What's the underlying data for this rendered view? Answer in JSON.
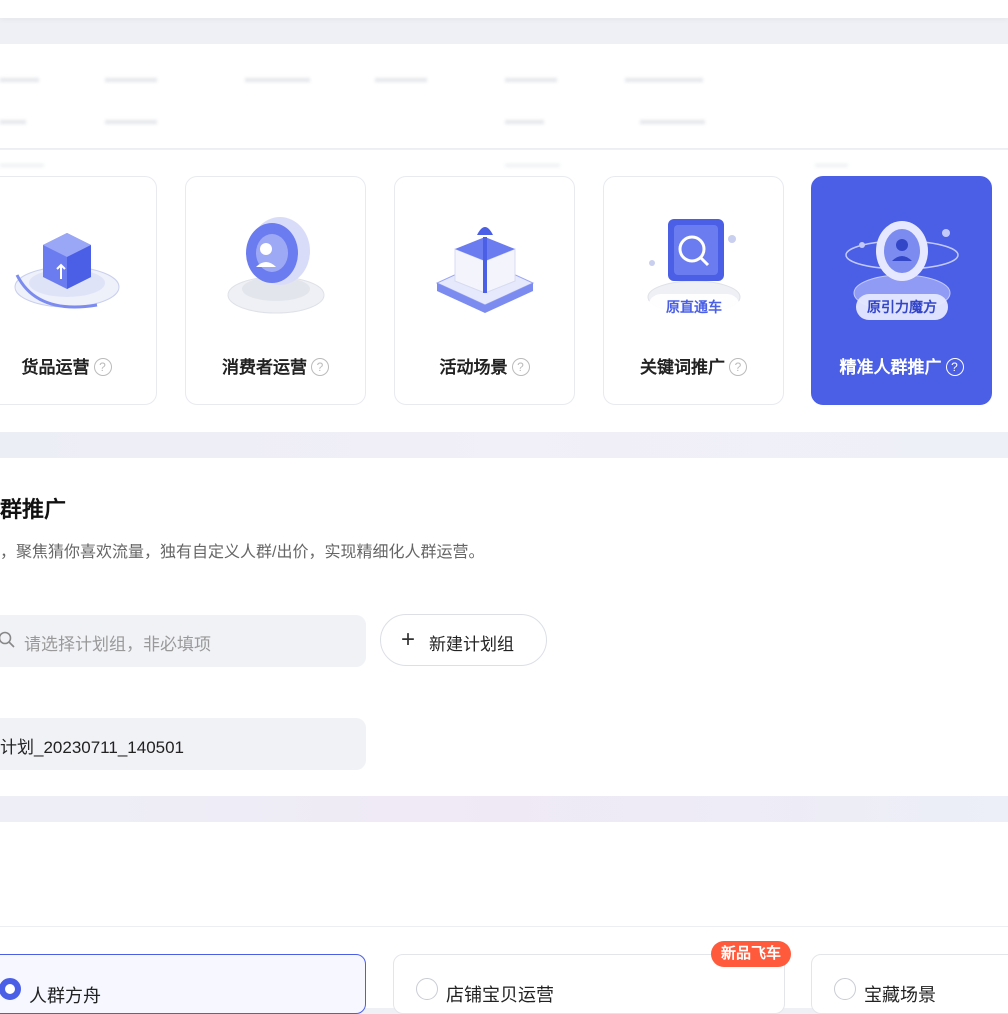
{
  "scenes": [
    {
      "label": "货品运营",
      "help": "?",
      "icon": "box-icon",
      "badge": ""
    },
    {
      "label": "消费者运营",
      "help": "?",
      "icon": "consumer-icon",
      "badge": ""
    },
    {
      "label": "活动场景",
      "help": "?",
      "icon": "gift-box-icon",
      "badge": ""
    },
    {
      "label": "关键词推广",
      "help": "?",
      "icon": "keyword-search-icon",
      "badge": "原直通车"
    },
    {
      "label": "精准人群推广",
      "help": "?",
      "icon": "crowd-icon",
      "badge": "原引力魔方"
    }
  ],
  "active_scene": "精准人群推广",
  "section": {
    "title": "群推广",
    "description": "，聚焦猜你喜欢流量，独有自定义人群/出价，实现精细化人群运营。"
  },
  "plan_group": {
    "placeholder": "请选择计划组，非必填项",
    "new_button_label": "新建计划组",
    "plus_icon": "plus-icon",
    "search_icon": "search-icon"
  },
  "plan_name": {
    "value": "计划_20230711_140501"
  },
  "options": [
    {
      "label": "人群方舟",
      "selected": true
    },
    {
      "label": "店铺宝贝运营",
      "selected": false,
      "tag": "新品飞车"
    },
    {
      "label": "宝藏场景",
      "selected": false
    }
  ],
  "colors": {
    "accent": "#4b5fe6",
    "tag": "#ff5a3c"
  }
}
